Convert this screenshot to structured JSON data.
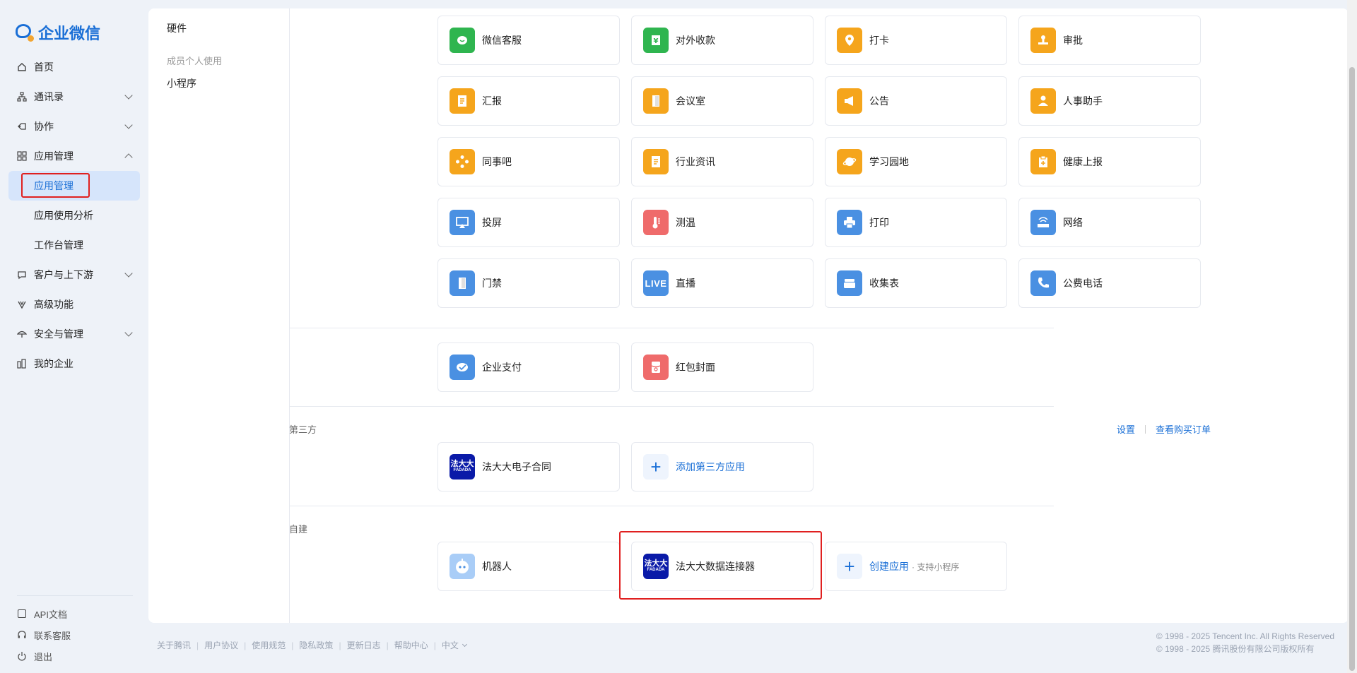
{
  "brand": {
    "name": "企业微信"
  },
  "sidebar": {
    "items": [
      {
        "label": "首页"
      },
      {
        "label": "通讯录"
      },
      {
        "label": "协作"
      },
      {
        "label": "应用管理"
      }
    ],
    "app_sub": [
      {
        "label": "应用管理"
      },
      {
        "label": "应用使用分析"
      },
      {
        "label": "工作台管理"
      }
    ],
    "items2": [
      {
        "label": "客户与上下游"
      },
      {
        "label": "高级功能"
      },
      {
        "label": "安全与管理"
      },
      {
        "label": "我的企业"
      }
    ],
    "bottom": [
      {
        "label": "API文档"
      },
      {
        "label": "联系客服"
      },
      {
        "label": "退出"
      }
    ]
  },
  "subnav": {
    "hardware": "硬件",
    "personal": "成员个人使用",
    "miniprogram": "小程序"
  },
  "apps": [
    {
      "label": "微信客服",
      "color": "#2fb54f",
      "glyph": "chat"
    },
    {
      "label": "对外收款",
      "color": "#2fb54f",
      "glyph": "yen"
    },
    {
      "label": "打卡",
      "color": "#f5a51c",
      "glyph": "pin"
    },
    {
      "label": "审批",
      "color": "#f5a51c",
      "glyph": "stamp"
    },
    {
      "label": "汇报",
      "color": "#f5a51c",
      "glyph": "doc"
    },
    {
      "label": "会议室",
      "color": "#f5a51c",
      "glyph": "door"
    },
    {
      "label": "公告",
      "color": "#f5a51c",
      "glyph": "horn"
    },
    {
      "label": "人事助手",
      "color": "#f5a51c",
      "glyph": "person"
    },
    {
      "label": "同事吧",
      "color": "#f5a51c",
      "glyph": "diamond"
    },
    {
      "label": "行业资讯",
      "color": "#f5a51c",
      "glyph": "doc"
    },
    {
      "label": "学习园地",
      "color": "#f5a51c",
      "glyph": "planet"
    },
    {
      "label": "健康上报",
      "color": "#f5a51c",
      "glyph": "clip"
    },
    {
      "label": "投屏",
      "color": "#4a90e2",
      "glyph": "screen"
    },
    {
      "label": "测温",
      "color": "#ef6b6b",
      "glyph": "therm"
    },
    {
      "label": "打印",
      "color": "#4a90e2",
      "glyph": "print"
    },
    {
      "label": "网络",
      "color": "#4a90e2",
      "glyph": "router"
    },
    {
      "label": "门禁",
      "color": "#4a90e2",
      "glyph": "door"
    },
    {
      "label": "直播",
      "color": "#4a90e2",
      "glyph": "live"
    },
    {
      "label": "收集表",
      "color": "#4a90e2",
      "glyph": "stack"
    },
    {
      "label": "公费电话",
      "color": "#4a90e2",
      "glyph": "phone"
    }
  ],
  "pay_apps": [
    {
      "label": "企业支付",
      "color": "#4a90e2",
      "glyph": "pay"
    },
    {
      "label": "红包封面",
      "color": "#ef6b6b",
      "glyph": "envelope"
    }
  ],
  "third_party": {
    "title": "第三方",
    "settings_link": "设置",
    "orders_link": "查看购买订单",
    "fadada_icon_text": "法大大",
    "fadada_icon_sub": "FADADA",
    "app_label": "法大大电子合同",
    "add_label": "添加第三方应用"
  },
  "custom": {
    "title": "自建",
    "robot_label": "机器人",
    "connector_label": "法大大数据连接器",
    "create_label": "创建应用",
    "create_sub": "· 支持小程序"
  },
  "live_text": "LIVE",
  "footer": {
    "links": [
      "关于腾讯",
      "用户协议",
      "使用规范",
      "隐私政策",
      "更新日志",
      "帮助中心",
      "中文"
    ],
    "copyright_en": "© 1998 - 2025 Tencent Inc. All Rights Reserved",
    "copyright_cn": "© 1998 - 2025 腾讯股份有限公司版权所有"
  }
}
